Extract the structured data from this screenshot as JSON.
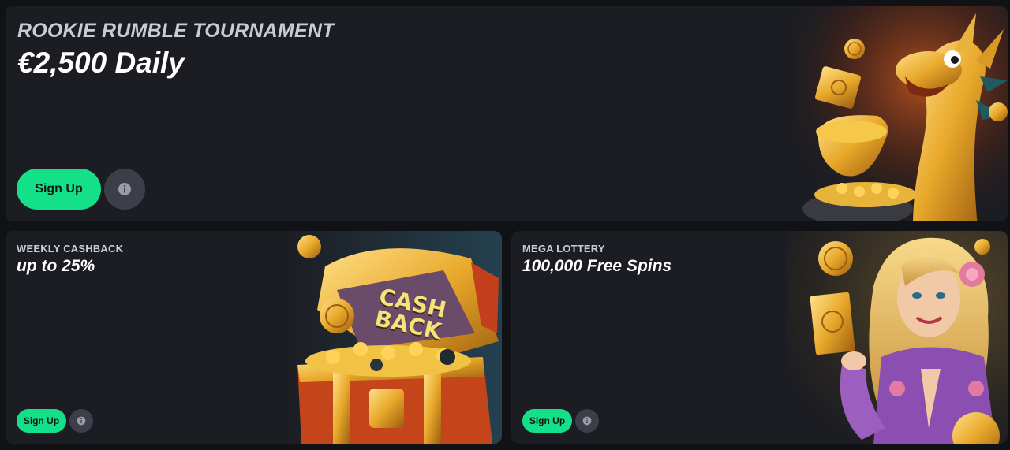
{
  "promos": {
    "top": {
      "kicker": "ROOKIE RUMBLE TOURNAMENT",
      "headline": "€2,500 Daily",
      "signup_label": "Sign Up",
      "artwork": "golden-dragon-with-coin-pot"
    },
    "cashback": {
      "kicker": "WEEKLY CASHBACK",
      "headline": "up to 25%",
      "signup_label": "Sign Up",
      "chest_text_line1": "CASH",
      "chest_text_line2": "BACK",
      "artwork": "treasure-chest-with-gold-coins"
    },
    "lottery": {
      "kicker": "MEGA LOTTERY",
      "headline": "100,000 Free Spins",
      "signup_label": "Sign Up",
      "artwork": "blonde-woman-holding-gold-ticket"
    }
  },
  "colors": {
    "page_bg": "#111215",
    "card_bg": "#1c1d22",
    "accent": "#14e08a",
    "info_bg": "#3c3e48",
    "gold": "#e8b33a"
  },
  "icons": [
    "info-icon"
  ]
}
